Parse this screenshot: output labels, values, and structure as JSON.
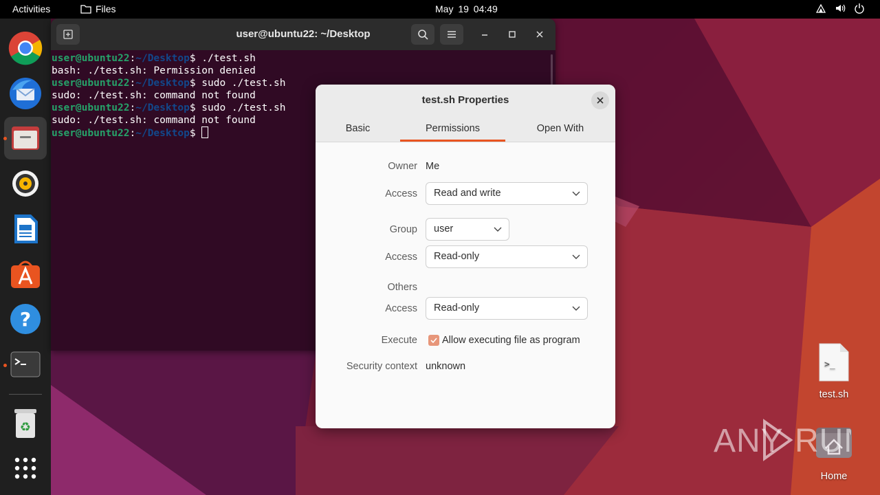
{
  "topbar": {
    "activities": "Activities",
    "files": "Files",
    "clock": "May 19  04:49"
  },
  "dock": {
    "items": [
      {
        "name": "chrome"
      },
      {
        "name": "thunderbird"
      },
      {
        "name": "files"
      },
      {
        "name": "rhythmbox"
      },
      {
        "name": "writer"
      },
      {
        "name": "app-center"
      },
      {
        "name": "help"
      },
      {
        "name": "terminal"
      },
      {
        "name": "trash"
      },
      {
        "name": "app-grid"
      }
    ]
  },
  "terminal": {
    "title": "user@ubuntu22: ~/Desktop",
    "prompt_user": "user@ubuntu22",
    "prompt_path": "~/Desktop",
    "lines": [
      {
        "cmd": " ./test.sh"
      },
      {
        "out": "bash: ./test.sh: Permission denied"
      },
      {
        "cmd": " sudo ./test.sh"
      },
      {
        "out": "sudo: ./test.sh: command not found"
      },
      {
        "cmd": " sudo ./test.sh"
      },
      {
        "out": "sudo: ./test.sh: command not found"
      }
    ]
  },
  "dialog": {
    "title": "test.sh Properties",
    "tabs": [
      "Basic",
      "Permissions",
      "Open With"
    ],
    "active_tab": "Permissions",
    "owner_label": "Owner",
    "owner_value": "Me",
    "owner_access_label": "Access",
    "owner_access": "Read and write",
    "group_label": "Group",
    "group_value": "user",
    "group_access_label": "Access",
    "group_access": "Read-only",
    "others_label": "Others",
    "others_access_label": "Access",
    "others_access": "Read-only",
    "execute_label": "Execute",
    "execute_checkbox": "Allow executing file as program",
    "execute_checked": true,
    "security_label": "Security context",
    "security_value": "unknown"
  },
  "desktop": {
    "file_icon_label": "test.sh",
    "home_icon_label": "Home",
    "watermark": "ANY RUN"
  },
  "colors": {
    "accent": "#e95420",
    "terminal_bg": "#300a24",
    "prompt_user": "#26a269",
    "prompt_path": "#12488b"
  }
}
